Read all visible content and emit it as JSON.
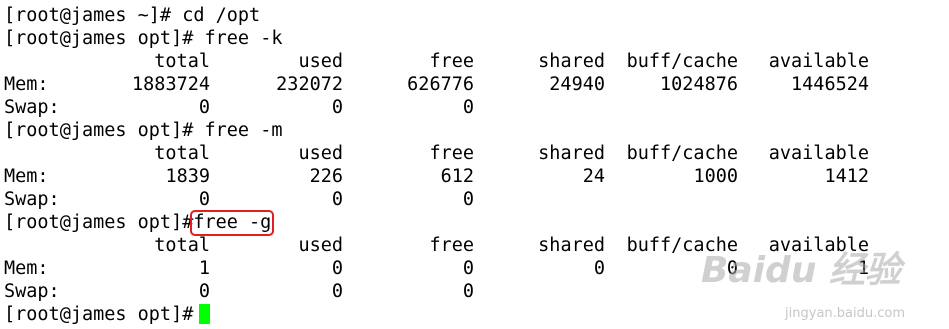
{
  "terminal": {
    "prompt_home": "[root@james ~]#",
    "prompt_opt": "[root@james opt]#",
    "cmd_cd": "cd /opt",
    "cmd_free_k": "free -k",
    "cmd_free_m": "free -m",
    "cmd_free_g": "free -g",
    "headers": [
      "total",
      "used",
      "free",
      "shared",
      "buff/cache",
      "available"
    ],
    "mem_label": "Mem:",
    "swap_label": "Swap:",
    "k": {
      "mem": [
        "1883724",
        "232072",
        "626776",
        "24940",
        "1024876",
        "1446524"
      ],
      "swap": [
        "0",
        "0",
        "0"
      ]
    },
    "m": {
      "mem": [
        "1839",
        "226",
        "612",
        "24",
        "1000",
        "1412"
      ],
      "swap": [
        "0",
        "0",
        "0"
      ]
    },
    "g": {
      "mem": [
        "1",
        "0",
        "0",
        "0",
        "0",
        "1"
      ],
      "swap": [
        "0",
        "0",
        "0"
      ]
    },
    "cursor_color": "#00ff00",
    "highlight_color": "#e02020"
  },
  "watermark": {
    "logo_text": "Baidu 经验",
    "url": "jingyan.baidu.com"
  }
}
